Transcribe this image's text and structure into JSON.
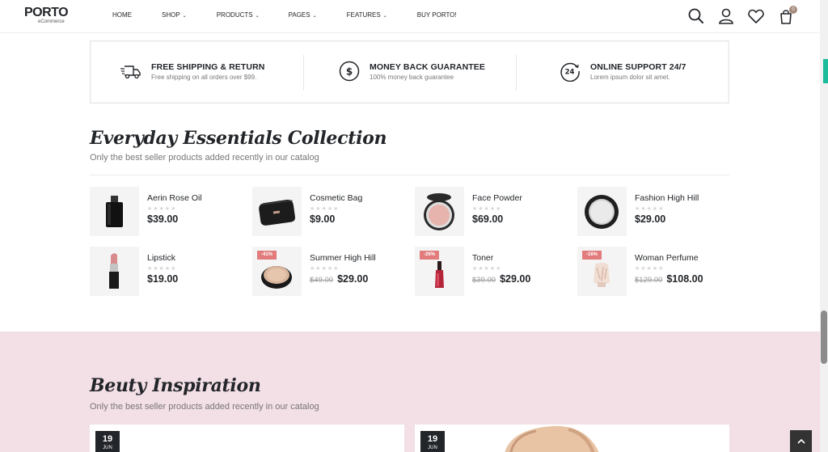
{
  "header": {
    "logo_main": "PORTO",
    "logo_sub": "eCommerce",
    "nav": [
      {
        "label": "HOME",
        "has_dropdown": false
      },
      {
        "label": "SHOP",
        "has_dropdown": true
      },
      {
        "label": "PRODUCTS",
        "has_dropdown": true
      },
      {
        "label": "PAGES",
        "has_dropdown": true
      },
      {
        "label": "FEATURES",
        "has_dropdown": true
      },
      {
        "label": "BUY PORTO!",
        "has_dropdown": false
      }
    ],
    "icons": [
      "search-icon",
      "user-icon",
      "heart-icon",
      "cart-icon"
    ],
    "cart_count": "0"
  },
  "features": [
    {
      "icon": "truck-icon",
      "title": "FREE SHIPPING & RETURN",
      "subtitle": "Free shipping on all orders over $99."
    },
    {
      "icon": "dollar-circle-icon",
      "title": "MONEY BACK GUARANTEE",
      "subtitle": "100% money back guarantee"
    },
    {
      "icon": "support-24-icon",
      "title": "ONLINE SUPPORT 24/7",
      "subtitle": "Lorem ipsum dolor sit amet."
    }
  ],
  "essentials": {
    "title": "Everyday Essentials Collection",
    "subtitle": "Only the best seller products added recently in our catalog",
    "products": [
      {
        "name": "Aerin Rose Oil",
        "price": "$39.00",
        "old_price": "",
        "sale": "",
        "image": "perfume-bottle"
      },
      {
        "name": "Cosmetic Bag",
        "price": "$9.00",
        "old_price": "",
        "sale": "",
        "image": "cosmetic-bag"
      },
      {
        "name": "Face Powder",
        "price": "$69.00",
        "old_price": "",
        "sale": "",
        "image": "face-powder"
      },
      {
        "name": "Fashion High Hill",
        "price": "$29.00",
        "old_price": "",
        "sale": "",
        "image": "compact-mirror"
      },
      {
        "name": "Lipstick",
        "price": "$19.00",
        "old_price": "",
        "sale": "",
        "image": "lipstick"
      },
      {
        "name": "Summer High Hill",
        "price": "$29.00",
        "old_price": "$49.00",
        "sale": "-41%",
        "image": "powder-compact"
      },
      {
        "name": "Toner",
        "price": "$29.00",
        "old_price": "$39.00",
        "sale": "-26%",
        "image": "toner-bottle"
      },
      {
        "name": "Woman Perfume",
        "price": "$108.00",
        "old_price": "$129.00",
        "sale": "-16%",
        "image": "woman-perfume"
      }
    ]
  },
  "inspiration": {
    "title": "Beuty Inspiration",
    "subtitle": "Only the best seller products added recently in our catalog",
    "posts": [
      {
        "day": "19",
        "month": "JUN"
      },
      {
        "day": "19",
        "month": "JUN"
      }
    ]
  },
  "colors": {
    "accent_sale": "#e27c7c",
    "pink_bg": "#f3dfe6",
    "dark": "#222529",
    "cart_badge": "#a58a7c"
  },
  "back_to_top_icon": "chevron-up-icon"
}
